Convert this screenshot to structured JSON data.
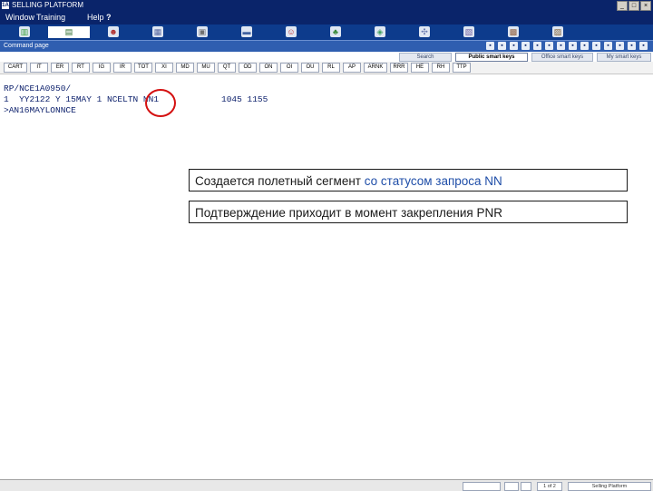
{
  "window": {
    "title": "SELLING PLATFORM",
    "logo": "1A",
    "minimize": "_",
    "maximize": "□",
    "close": "×"
  },
  "menu": {
    "window_label": "Window",
    "training_label": "Training",
    "help_label": "Help",
    "help_mark": "?"
  },
  "toolbar": {
    "icons": [
      {
        "name": "book-icon",
        "glyph": "▥",
        "color": "#3aa23a"
      },
      {
        "name": "page-icon",
        "glyph": "▤",
        "color": "#2a6a2a"
      },
      {
        "name": "agent-icon",
        "glyph": "☻",
        "color": "#b03030"
      },
      {
        "name": "contacts-icon",
        "glyph": "▦",
        "color": "#5a6aa0"
      },
      {
        "name": "tree-icon",
        "glyph": "▣",
        "color": "#707070"
      },
      {
        "name": "car-icon",
        "glyph": "▬",
        "color": "#4060a0"
      },
      {
        "name": "person-icon",
        "glyph": "☺",
        "color": "#c03030"
      },
      {
        "name": "palm-icon",
        "glyph": "♣",
        "color": "#3a8a3a"
      },
      {
        "name": "map-icon",
        "glyph": "◈",
        "color": "#40a060"
      },
      {
        "name": "settings-icon",
        "glyph": "✣",
        "color": "#6a7ab0"
      },
      {
        "name": "document-icon",
        "glyph": "▧",
        "color": "#7060a0"
      },
      {
        "name": "briefcase-icon",
        "glyph": "▩",
        "color": "#906040"
      },
      {
        "name": "report-icon",
        "glyph": "▨",
        "color": "#806030"
      }
    ]
  },
  "page": {
    "title": "Command page",
    "icons": [
      "a",
      "b",
      "c",
      "d",
      "e",
      "f",
      "g",
      "h",
      "i",
      "j",
      "k",
      "l",
      "m",
      "n"
    ]
  },
  "smarttabs": {
    "tabs": [
      "Search",
      "Public smart keys",
      "Office smart keys",
      "My smart keys"
    ]
  },
  "commands": [
    "CART",
    "IT",
    "ER",
    "RT",
    "IG",
    "IR",
    "TOT",
    "XI",
    "MD",
    "MU",
    "QT",
    "OD",
    "ON",
    "OI",
    "OU",
    "RL",
    "AP",
    "ARNK",
    "RRR",
    "HE",
    "RH",
    "TTP"
  ],
  "terminal": {
    "line1": "RP/NCE1A0950/",
    "line2a": "1  YY2122 Y 15MAY 1 NCELTN NN1",
    "line2b": "1045 1155",
    "line3": ">AN16MAYLONNCE"
  },
  "callout": {
    "line1_start": "Создается полетный сегмент ",
    "line1_highlight": "со статусом запроса NN",
    "line2": "Подтверждение приходит в момент закрепления PNR"
  },
  "status": {
    "page_counter": "1 of 2",
    "app_label": "Selling Platform"
  }
}
